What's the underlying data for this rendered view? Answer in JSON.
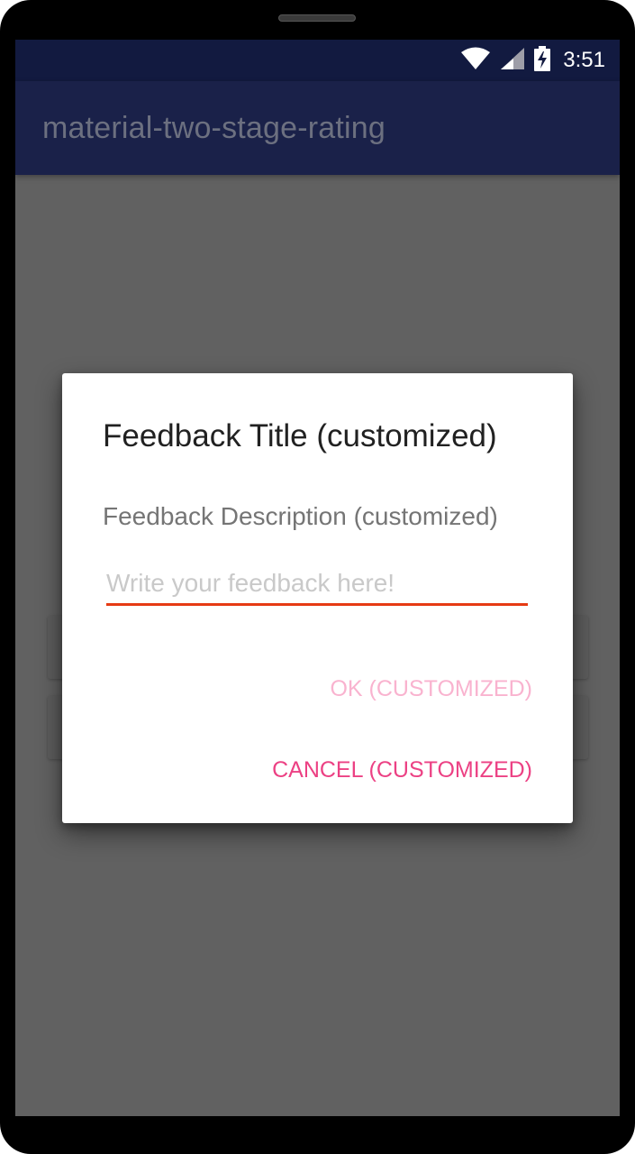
{
  "status_bar": {
    "time": "3:51",
    "icons": [
      "wifi-icon",
      "cell-signal-icon",
      "battery-charging-icon"
    ]
  },
  "app_bar": {
    "title": "material-two-stage-rating"
  },
  "dialog": {
    "title": "Feedback Title (customized)",
    "description": "Feedback Description (customized)",
    "input_placeholder": "Write your feedback here!",
    "input_value": "",
    "ok_label": "OK (CUSTOMIZED)",
    "cancel_label": "CANCEL (CUSTOMIZED)"
  },
  "colors": {
    "status_bar": "#121a40",
    "app_bar": "#1a2149",
    "scrim_background": "#616161",
    "input_underline": "#e63b14",
    "ok_button_disabled": "#f9b3cf",
    "cancel_button": "#ec4184"
  }
}
